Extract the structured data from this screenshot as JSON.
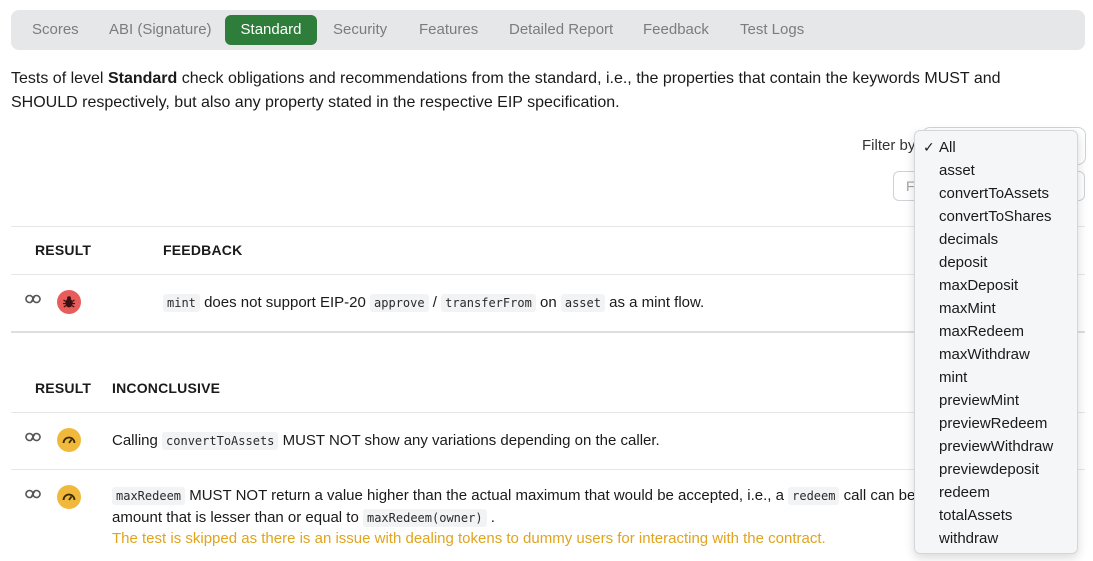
{
  "tabs": [
    "Scores",
    "ABI (Signature)",
    "Standard",
    "Security",
    "Features",
    "Detailed Report",
    "Feedback",
    "Test Logs"
  ],
  "active_tab": "Standard",
  "intro": {
    "prefix": "Tests of level ",
    "level": "Standard",
    "line1_rest": " check obligations and recommendations from the standard, i.e., the properties that contain the keywords MUST and",
    "line2": "SHOULD respectively, but also any property stated in the respective EIP specification."
  },
  "filter": {
    "label": "Filter by",
    "search_placeholder": "F"
  },
  "feedback_table": {
    "headers": {
      "result": "RESULT",
      "feedback": "FEEDBACK"
    },
    "row": {
      "p1": "mint",
      "p2": " does not support EIP-20 ",
      "p3": "approve",
      "p4": " / ",
      "p5": "transferFrom",
      "p6": " on ",
      "p7": "asset",
      "p8": " as a mint flow."
    }
  },
  "inconclusive_table": {
    "headers": {
      "result": "RESULT",
      "inconclusive": "INCONCLUSIVE"
    },
    "row1": {
      "p1": "Calling ",
      "p2": "convertToAssets",
      "p3": " MUST NOT show any variations depending on the caller."
    },
    "row2": {
      "p1": "maxRedeem",
      "p2": " MUST NOT return a value higher than the actual maximum that would be accepted, i.e., a ",
      "p3": "redeem",
      "p4": " call can be c",
      "p5": "amount that is lesser than or equal to ",
      "p6": "maxRedeem(owner)",
      "p7": " .",
      "warning": "The test is skipped as there is an issue with dealing tokens to dummy users for interacting with the contract."
    }
  },
  "dropdown": {
    "checkmark": "✓",
    "options": [
      "All",
      "asset",
      "convertToAssets",
      "convertToShares",
      "decimals",
      "deposit",
      "maxDeposit",
      "maxMint",
      "maxRedeem",
      "maxWithdraw",
      "mint",
      "previewMint",
      "previewRedeem",
      "previewWithdraw",
      "previewdeposit",
      "redeem",
      "totalAssets",
      "withdraw"
    ],
    "selected": "All"
  },
  "colors": {
    "accent": "#2e7d3a",
    "error_badge": "#e85c5c",
    "warning_badge": "#f1b93b",
    "warning_text": "#e0a41d"
  },
  "icons": {
    "row_link": "link-icon",
    "fail": "bug-icon",
    "inconclusive": "gauge-icon"
  }
}
